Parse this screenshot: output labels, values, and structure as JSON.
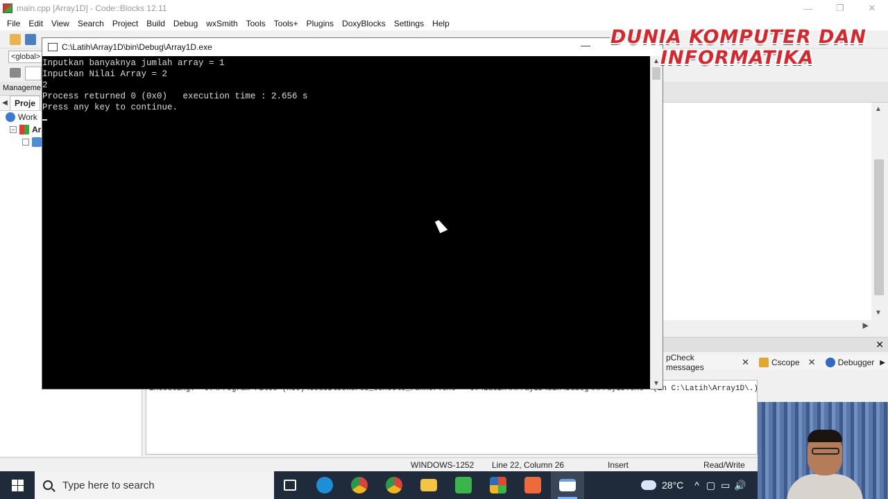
{
  "window": {
    "title": "main.cpp [Array1D] - Code::Blocks 12.11",
    "controls": [
      "—",
      "❐",
      "✕"
    ]
  },
  "menu": [
    "File",
    "Edit",
    "View",
    "Search",
    "Project",
    "Build",
    "Debug",
    "wxSmith",
    "Tools",
    "Tools+",
    "Plugins",
    "DoxyBlocks",
    "Settings",
    "Help"
  ],
  "toolbar": {
    "scope_combo": "<global>"
  },
  "management": {
    "header": "Manageme",
    "tab": "Proje",
    "tree": [
      {
        "label": "Work"
      },
      {
        "label": "Ar"
      }
    ]
  },
  "console": {
    "title": "C:\\Latih\\Array1D\\bin\\Debug\\Array1D.exe",
    "minimize": "—",
    "lines": [
      "Inputkan banyaknya jumlah array = 1",
      "Inputkan Nilai Array = 2",
      "2",
      "",
      "Process returned 0 (0x0)   execution time : 2.656 s",
      "Press any key to continue."
    ]
  },
  "logs": {
    "close": "✕",
    "tabs": [
      {
        "label": "pCheck messages",
        "icon": "",
        "color": "#ffffff"
      },
      {
        "label": "Cscope",
        "icon": "pencil-icon",
        "color": "#e0a82c"
      },
      {
        "label": "Debugger",
        "icon": "debugger-icon",
        "color": "#2d6cc0"
      }
    ],
    "output": "Executing: \"C:\\Program Files (x86)\\CodeBlocks/cb_console_runner.exe\" \"C:\\Latih\\Array1D\\bin\\Debug\\Array1D.exe\"  (in C:\\Latih\\Array1D\\.)"
  },
  "statusbar": {
    "encoding": "WINDOWS-1252",
    "position": "Line 22, Column 26",
    "mode": "Insert",
    "access": "Read/Write"
  },
  "watermark": {
    "line1": "DUNIA KOMPUTER DAN",
    "line2": "INFORMATIKA"
  },
  "taskbar": {
    "search_placeholder": "Type here to search",
    "apps": [
      {
        "name": "task-view",
        "color": "#ffffff"
      },
      {
        "name": "edge",
        "color": "#1c8fd6"
      },
      {
        "name": "chrome-alt",
        "color": "#d9443a"
      },
      {
        "name": "chrome",
        "color": "#f2b51d"
      },
      {
        "name": "file-explorer",
        "color": "#f4c542"
      },
      {
        "name": "camtasia",
        "color": "#3bb54a"
      },
      {
        "name": "codeblocks",
        "color": "#e04a2f"
      },
      {
        "name": "orange-app",
        "color": "#ee6a3c"
      },
      {
        "name": "console",
        "color": "#ffffff"
      }
    ],
    "weather": "28°C",
    "tray_icons": [
      "^",
      "▢",
      "▭",
      "🔊"
    ]
  }
}
